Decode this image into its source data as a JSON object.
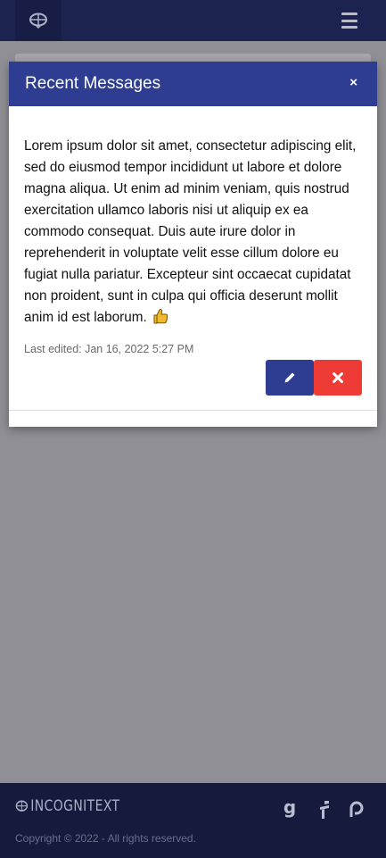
{
  "navbar": {
    "logo_icon": "brain-logo-icon",
    "menu_icon": "hamburger-menu-icon"
  },
  "modal": {
    "title": "Recent Messages",
    "close_label": "×",
    "message": "Lorem ipsum dolor sit amet, consectetur adipiscing elit, sed do eiusmod tempor incididunt ut labore et dolore magna aliqua. Ut enim ad minim veniam, quis nostrud exercitation ullamco laboris nisi ut aliquip ex ea commodo consequat. Duis aute irure dolor in reprehenderit in voluptate velit esse cillum dolore eu fugiat nulla pariatur. Excepteur sint occaecat cupidatat non proident, sunt in culpa qui officia deserunt mollit anim id est laborum.",
    "emoji": "thumbs-up-icon",
    "last_edited": "Last edited: Jan 16, 2022 5:27 PM",
    "edit_icon": "pencil-icon",
    "delete_icon": "x-icon",
    "colors": {
      "header": "#2e3d92",
      "edit_button": "#2e3d92",
      "delete_button": "#ee3b36"
    }
  },
  "footer": {
    "brand": "INCOGNITEXT",
    "copyright": "Copyright © 2022 - All rights reserved.",
    "social": [
      {
        "icon": "goodreads-icon",
        "glyph": "g"
      },
      {
        "icon": "flipboard-icon",
        "glyph": "f"
      },
      {
        "icon": "patreon-icon",
        "glyph": "P"
      }
    ]
  }
}
